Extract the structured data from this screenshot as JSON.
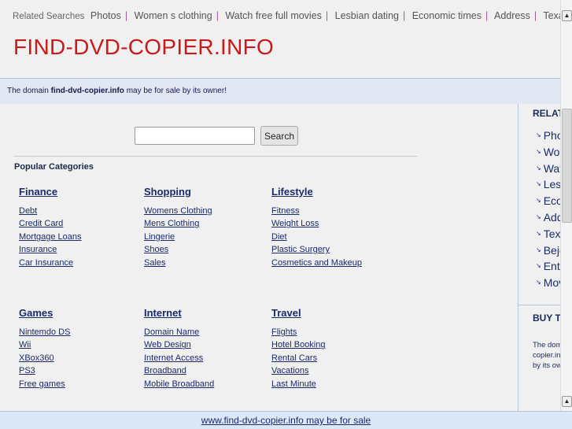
{
  "related": {
    "label": "Related Searches",
    "items": [
      "Photos",
      "Women s clothing",
      "Watch free full movies",
      "Lesbian dating",
      "Economic times",
      "Address",
      "Texas tag"
    ]
  },
  "site_title": "FIND-DVD-COPIER.INFO",
  "notice": {
    "prefix": "The domain ",
    "domain": "find-dvd-copier.info",
    "suffix": " may be for sale by its owner!"
  },
  "search": {
    "value": "",
    "button": "Search"
  },
  "popular_heading": "Popular Categories",
  "categories": [
    {
      "title": "Finance",
      "links": [
        "Debt",
        "Credit Card",
        "Mortgage Loans",
        "Insurance",
        "Car Insurance"
      ]
    },
    {
      "title": "Shopping",
      "links": [
        "Womens Clothing",
        "Mens Clothing",
        "Lingerie",
        "Shoes",
        "Sales"
      ]
    },
    {
      "title": "Lifestyle",
      "links": [
        "Fitness",
        "Weight Loss",
        "Diet",
        "Plastic Surgery",
        "Cosmetics and Makeup"
      ]
    },
    {
      "title": "Games",
      "links": [
        "Nintemdo DS",
        "Wii",
        "XBox360",
        "PS3",
        "Free games"
      ]
    },
    {
      "title": "Internet",
      "links": [
        "Domain Name",
        "Web Design",
        "Internet Access",
        "Broadband",
        "Mobile Broadband"
      ]
    },
    {
      "title": "Travel",
      "links": [
        "Flights",
        "Hotel Booking",
        "Rental Cars",
        "Vacations",
        "Last Minute"
      ]
    }
  ],
  "sidebar": {
    "heading": "RELATED",
    "items": [
      "Photos",
      "Women s clothing",
      "Watch free full movies",
      "Lesbian dating",
      "Economic times",
      "Address",
      "Texas tag",
      "Bejeweled",
      "Entertainment",
      "Movies"
    ],
    "buy_heading": "BUY THIS DOMAIN",
    "buy_text": "The domain find-dvd-copier.info may be for sale by its owner!"
  },
  "footer_link": "www.find-dvd-copier.info may be for sale"
}
